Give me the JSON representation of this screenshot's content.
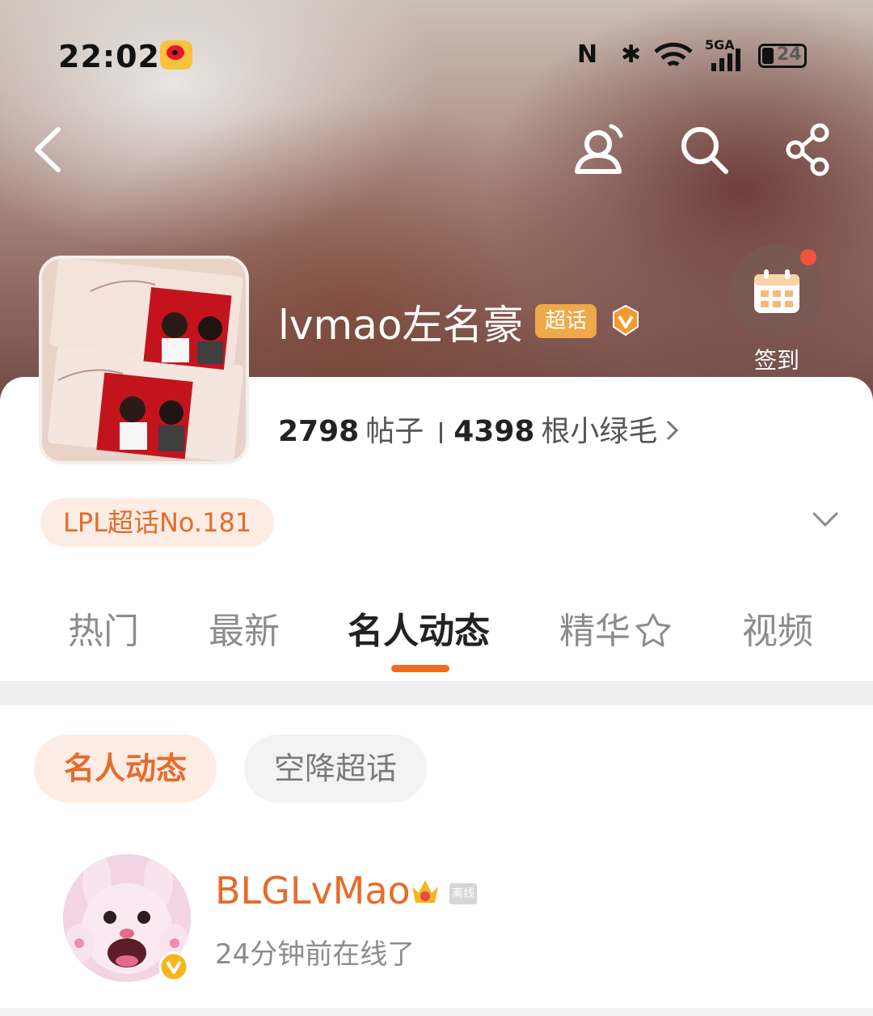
{
  "status_bar": {
    "time": "22:02",
    "network": "5GA",
    "battery": "24"
  },
  "header": {
    "topic_name": "lvmao左名豪",
    "super_topic_badge": "超话",
    "checkin_label": "签到"
  },
  "stats": {
    "posts_count": "2798",
    "posts_unit": "帖子",
    "fans_count": "4398",
    "fans_unit": "根小绿毛"
  },
  "rank_badge": "LPL超话No.181",
  "tabs": [
    {
      "label": "热门"
    },
    {
      "label": "最新"
    },
    {
      "label": "名人动态",
      "active": true
    },
    {
      "label": "精华"
    },
    {
      "label": "视频"
    }
  ],
  "filter_pills": [
    {
      "label": "名人动态",
      "active": true
    },
    {
      "label": "空降超话"
    }
  ],
  "user": {
    "name": "BLGLvMao",
    "status_tag": "离线",
    "online_text": "24分钟前在线了"
  },
  "colors": {
    "accent": "#EE6A1D",
    "badge": "#EFA84A"
  },
  "icons": [
    "back-icon",
    "person-icon",
    "search-icon",
    "share-icon",
    "calendar-icon",
    "v-badge-icon",
    "crown-icon",
    "chevron-down-icon"
  ]
}
